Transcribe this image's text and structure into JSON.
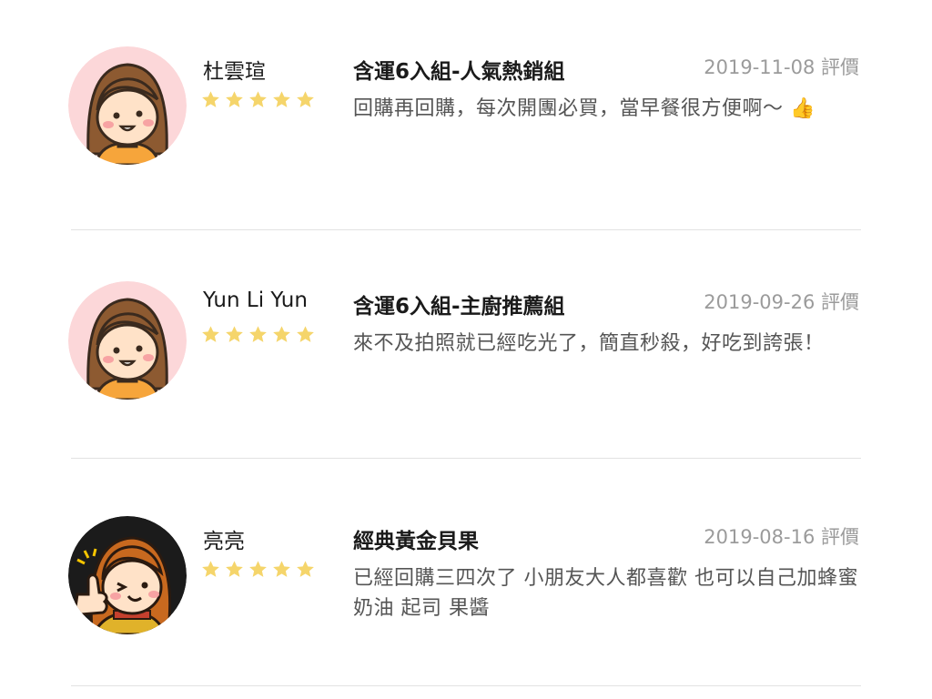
{
  "reviews": [
    {
      "name": "杜雲瑄",
      "rating": 5,
      "product": "含運6入組-人氣熱銷組",
      "date": "2019-11-08 評價",
      "comment": "回購再回購，每次開團必買，當早餐很方便啊～ 👍",
      "avatar": "girl-smiling-avatar"
    },
    {
      "name": "Yun Li Yun",
      "rating": 5,
      "product": "含運6入組-主廚推薦組",
      "date": "2019-09-26 評價",
      "comment": "來不及拍照就已經吃光了，簡直秒殺，好吃到誇張！",
      "avatar": "girl-smiling-avatar"
    },
    {
      "name": "亮亮",
      "rating": 5,
      "product": "經典黃金貝果",
      "date": "2019-08-16 評價",
      "comment": "已經回購三四次了  小朋友大人都喜歡  也可以自己加蜂蜜 奶油 起司 果醬",
      "avatar": "girl-thumbs-up-avatar"
    }
  ],
  "colors": {
    "star": "#f5d56b",
    "avatar_bg_pink": "#fcd7d9",
    "avatar_bg_dark": "#1b1b1b",
    "hair": "#8d5a31",
    "divider": "#e2e2e2"
  }
}
